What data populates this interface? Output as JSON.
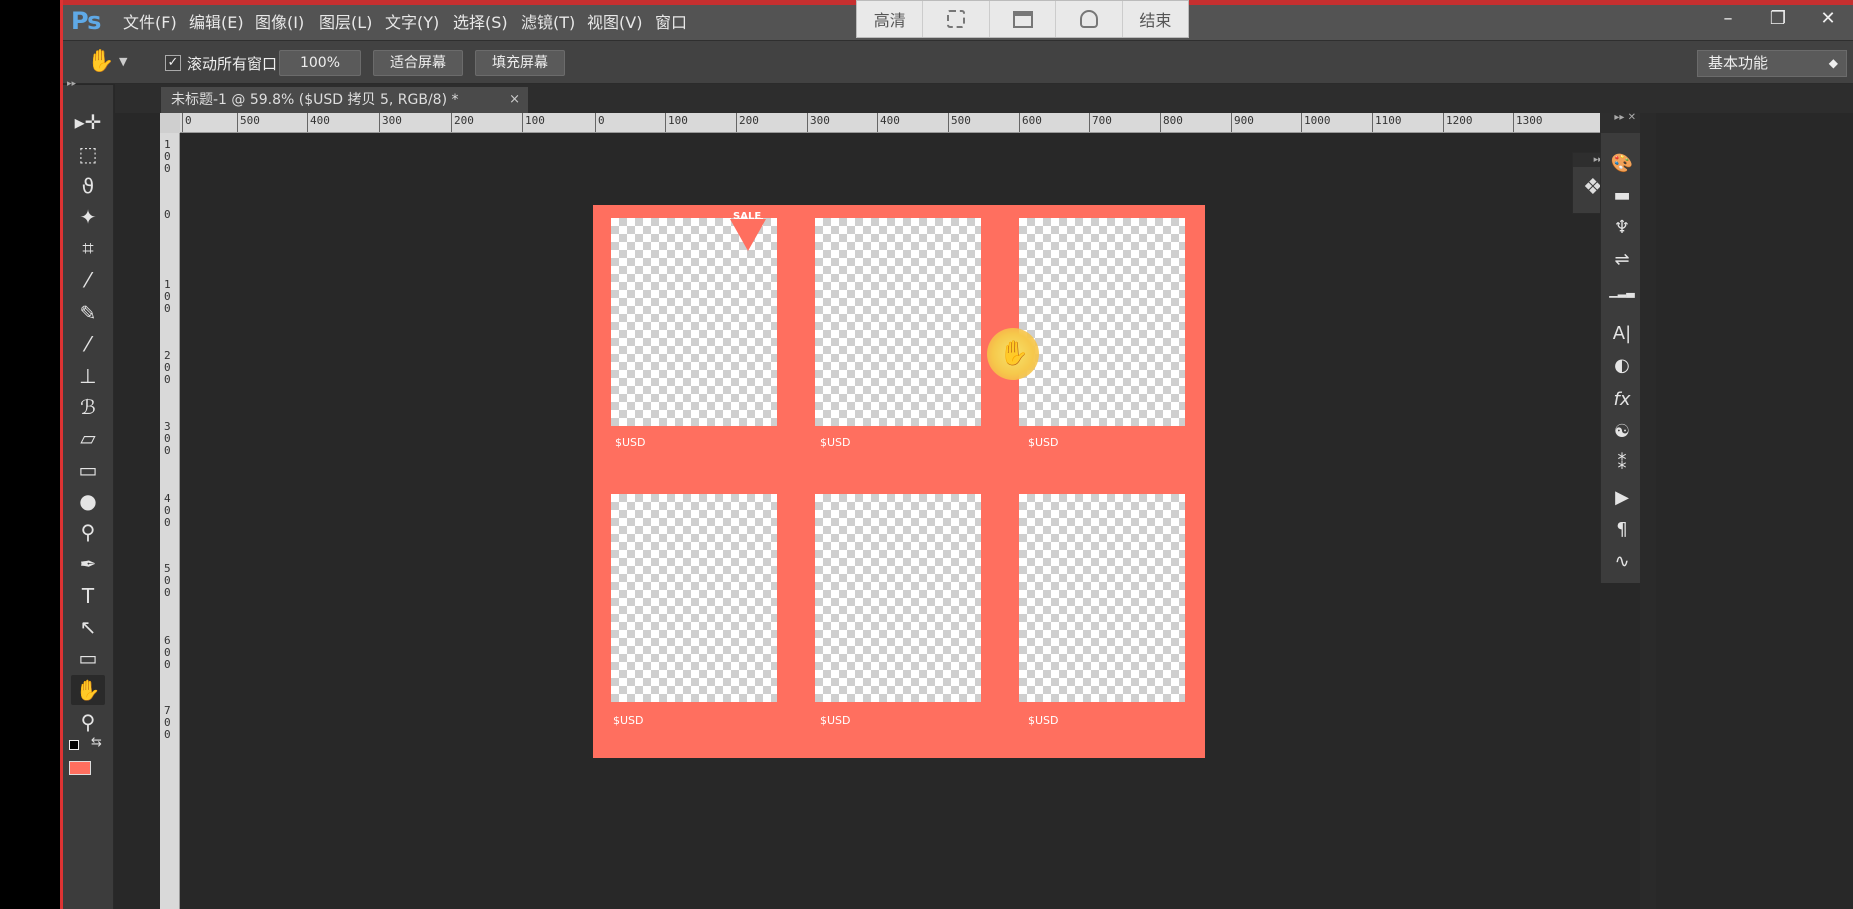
{
  "app": {
    "logo": "Ps"
  },
  "menu": [
    {
      "label": "文件(F)"
    },
    {
      "label": "编辑(E)"
    },
    {
      "label": "图像(I)"
    },
    {
      "label": "图层(L)"
    },
    {
      "label": "文字(Y)"
    },
    {
      "label": "选择(S)"
    },
    {
      "label": "滤镜(T)"
    },
    {
      "label": "视图(V)"
    },
    {
      "label": "窗口"
    }
  ],
  "window_controls": {
    "minimize": "–",
    "restore": "❐",
    "close": "✕"
  },
  "recording_toolbar": {
    "hd": "高清",
    "end": "结束"
  },
  "options": {
    "scroll_all_checked": "✓",
    "scroll_all_label": "滚动所有窗口",
    "btn_100": "100%",
    "btn_fit": "适合屏幕",
    "btn_fill": "填充屏幕",
    "workspace": "基本功能"
  },
  "document": {
    "tab_title": "未标题-1 @ 59.8% ($USD 拷贝 5, RGB/8) *",
    "close": "×"
  },
  "ruler_top": [
    "0",
    "500",
    "400",
    "300",
    "200",
    "100",
    "0",
    "100",
    "200",
    "300",
    "400",
    "500",
    "600",
    "700",
    "800",
    "900",
    "1000",
    "1100",
    "1200",
    "1300"
  ],
  "ruler_left": [
    "100",
    "0",
    "100",
    "200",
    "300",
    "400",
    "500",
    "600",
    "700"
  ],
  "canvas": {
    "sale_label": "SALE",
    "cells": [
      {
        "price": "$USD"
      },
      {
        "price": "$USD"
      },
      {
        "price": "$USD"
      },
      {
        "price": "$USD"
      },
      {
        "price": "$USD"
      },
      {
        "price": "$USD"
      }
    ],
    "background_color": "#ff6f5f"
  },
  "tools": [
    "move-tool",
    "marquee-tool",
    "lasso-tool",
    "magic-wand-tool",
    "crop-tool",
    "eyedropper-tool",
    "healing-brush-tool",
    "brush-tool",
    "clone-stamp-tool",
    "history-brush-tool",
    "eraser-tool",
    "gradient-tool",
    "blur-tool",
    "dodge-tool",
    "pen-tool",
    "type-tool",
    "path-selection-tool",
    "shape-tool",
    "hand-tool",
    "zoom-tool"
  ],
  "tool_glyphs": {
    "move": "▸✛",
    "marquee": "⬚",
    "lasso": "ϑ",
    "wand": "✦",
    "crop": "⌗",
    "eyedropper": "⁄",
    "heal": "✎",
    "brush": "⁄",
    "stamp": "⊥",
    "history": "ℬ",
    "eraser": "▱",
    "gradient": "▭",
    "blur": "●",
    "dodge": "⚲",
    "pen": "✒",
    "type": "T",
    "path": "↖",
    "shape": "▭",
    "hand": "✋",
    "zoom": "⚲"
  },
  "right_dock_glyphs": {
    "color": "🎨",
    "swatches": "▬",
    "adjust": "♆",
    "properties": "⇌",
    "histogram": "▁▂▃",
    "character": "A|",
    "styles": "◐",
    "fx": "fx",
    "channels": "☯",
    "paths": "⁑",
    "actions": "▶",
    "paragraph": "¶",
    "curves": "∿"
  },
  "mini_panel": {
    "head": "▸▸ ✕",
    "layers_glyph": "❖"
  },
  "dock_head": "▸▸ ✕"
}
